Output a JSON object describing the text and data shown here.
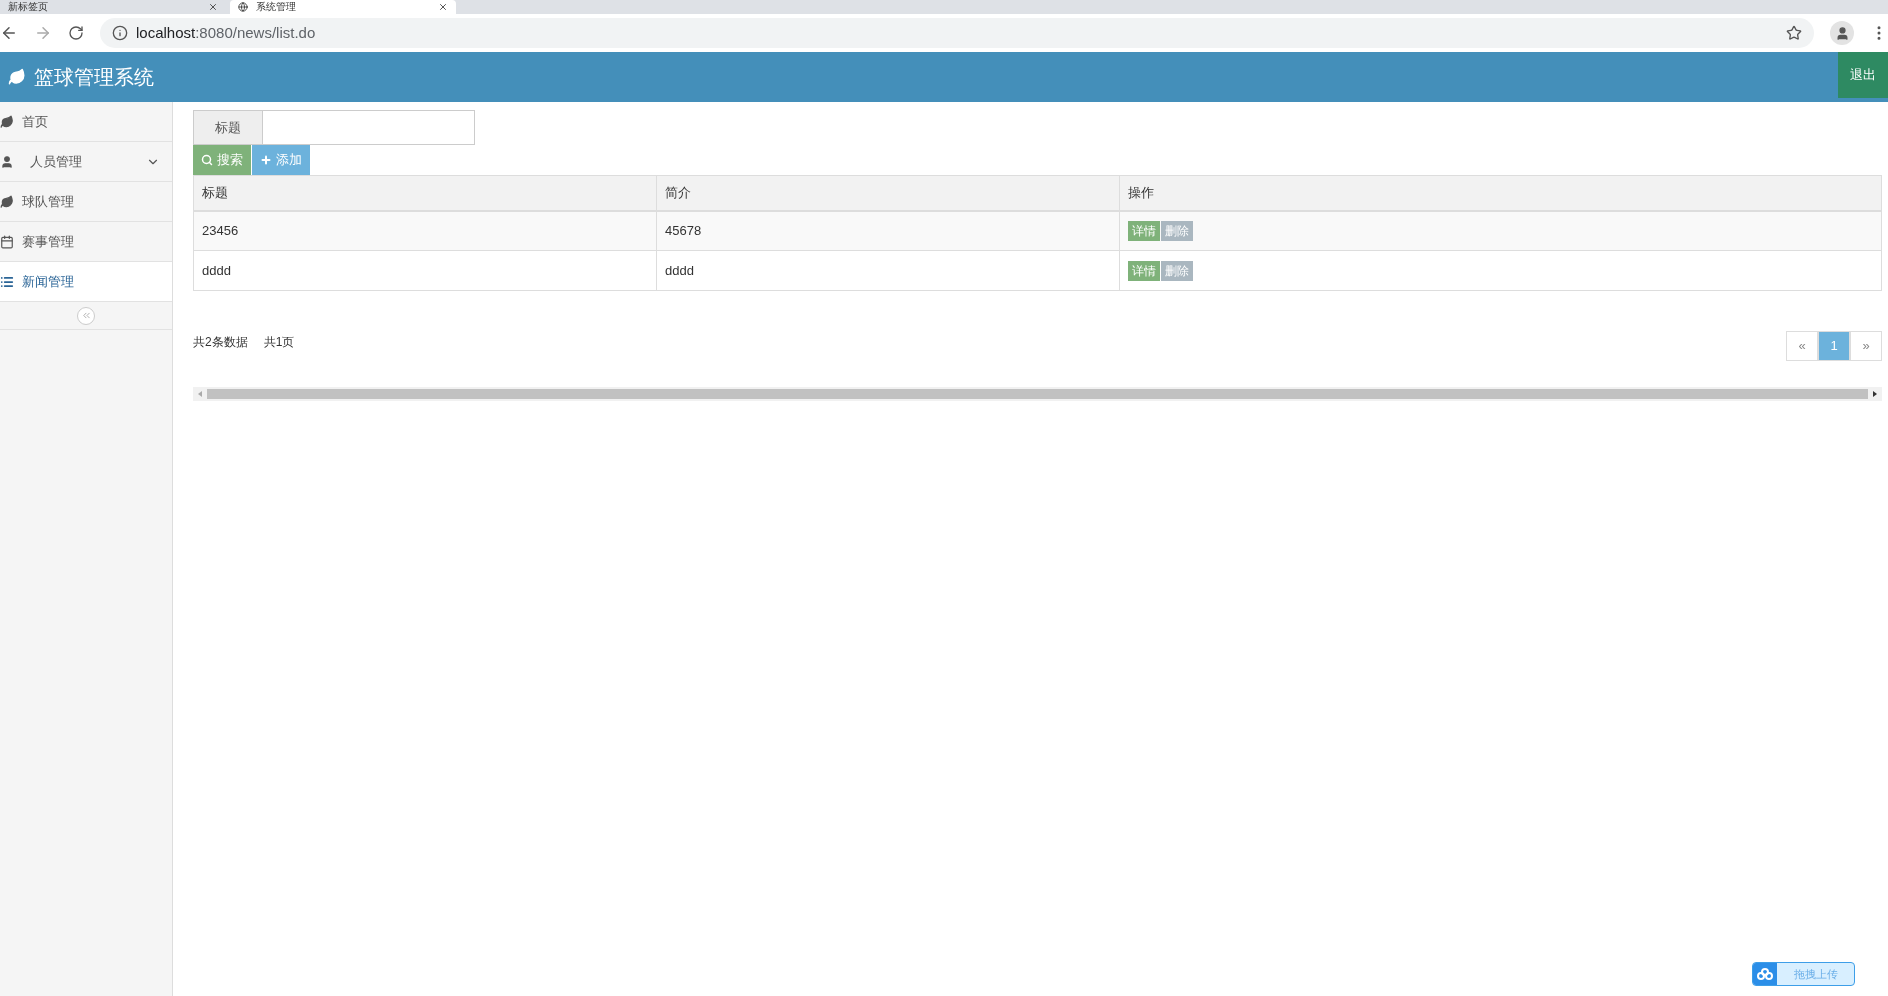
{
  "browser": {
    "tabs": [
      {
        "title": "新标签页",
        "selected": false
      },
      {
        "title": "系统管理",
        "selected": true
      }
    ],
    "url_host": "localhost",
    "url_rest": ":8080/news/list.do"
  },
  "header": {
    "title": "篮球管理系统",
    "logout": "退出"
  },
  "sidebar": {
    "items": [
      {
        "label": "首页",
        "selected": false,
        "expandable": false
      },
      {
        "label": "人员管理",
        "selected": false,
        "expandable": true
      },
      {
        "label": "球队管理",
        "selected": false,
        "expandable": false
      },
      {
        "label": "赛事管理",
        "selected": false,
        "expandable": false
      },
      {
        "label": "新闻管理",
        "selected": true,
        "expandable": false
      }
    ]
  },
  "search": {
    "label": "标题",
    "search_button": "搜索",
    "add_button": "添加"
  },
  "table": {
    "columns": [
      "标题",
      "简介",
      "操作"
    ],
    "rows": [
      {
        "title": "23456",
        "intro": "45678",
        "actions": [
          "详情",
          "删除"
        ]
      },
      {
        "title": "dddd",
        "intro": "dddd",
        "actions": [
          "详情",
          "删除"
        ]
      }
    ]
  },
  "footer": {
    "total": "共2条数据",
    "pages": "共1页",
    "pagination": [
      {
        "label": "«",
        "selected": false
      },
      {
        "label": "1",
        "selected": true
      },
      {
        "label": "»",
        "selected": false
      }
    ]
  },
  "upload": {
    "label": "拖拽上传"
  }
}
